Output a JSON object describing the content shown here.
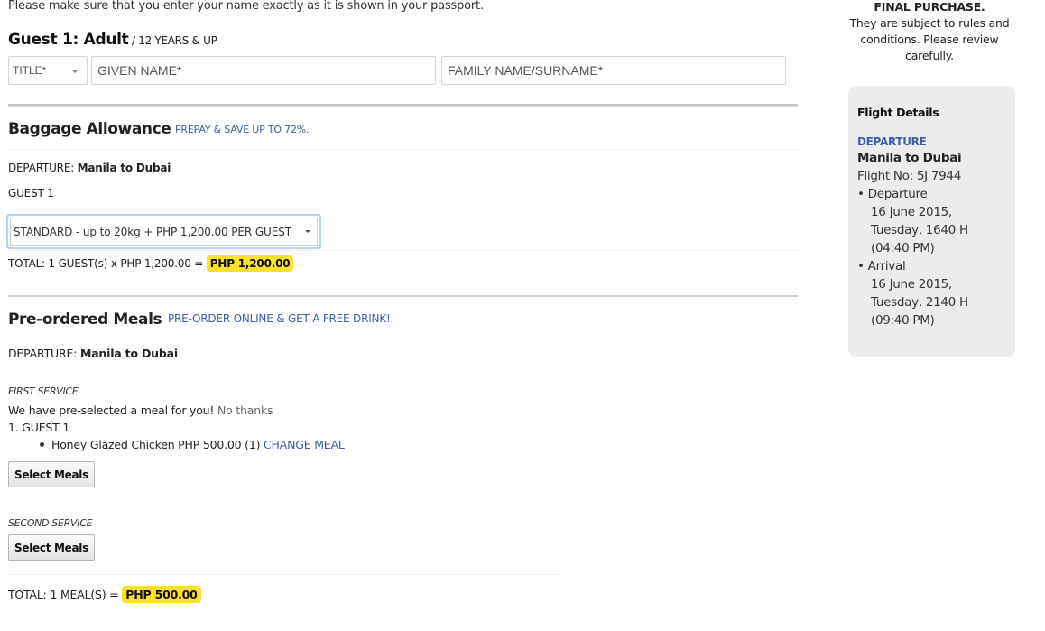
{
  "notice": "Please make sure that you enter your name exactly as it is shown in your passport.",
  "guest": {
    "heading": "Guest  1:  Adult",
    "subheading": " / 12 YEARS & UP",
    "title_select": "TITLE*",
    "given_name_placeholder": "GIVEN NAME*",
    "family_name_placeholder": "FAMILY NAME/SURNAME*"
  },
  "baggage": {
    "title": "Baggage Allowance",
    "promo": "PREPAY & SAVE UP TO 72%.",
    "departure_label": "DEPARTURE: ",
    "departure_route": "Manila  to  Dubai",
    "guest_label": "GUEST 1",
    "selected_option": "STANDARD - up to 20kg + PHP 1,200.00 PER GUEST",
    "total_label": "TOTAL:  1 GUEST(s) x PHP 1,200.00 = ",
    "total_value": "PHP  1,200.00"
  },
  "meals": {
    "title": "Pre-ordered Meals",
    "promo": "PRE-ORDER ONLINE & GET A FREE DRINK!",
    "departure_label": "DEPARTURE: ",
    "departure_route": "Manila  to  Dubai",
    "first_service": {
      "label": "FIRST SERVICE",
      "preselected_text": "We have pre-selected a meal for you! ",
      "no_thanks": "No thanks",
      "guest_label": "1. GUEST 1",
      "meal_item": "Honey Glazed Chicken PHP 500.00 (1) ",
      "change_meal": "CHANGE MEAL",
      "button": "Select Meals"
    },
    "second_service": {
      "label": "SECOND SERVICE",
      "button": "Select Meals"
    },
    "total_label": "TOTAL: 1 MEAL(S) = ",
    "total_value": "PHP 500.00"
  },
  "sidebar": {
    "final_purchase": "FINAL PURCHASE.",
    "rules_text": "They are subject to rules and conditions. Please review carefully.",
    "flight_details": {
      "title": "Flight Details",
      "direction": "DEPARTURE",
      "route": "Manila to Dubai",
      "flight_no": "Flight No: 5J 7944",
      "departure_label": "• Departure",
      "departure_date": "16 June 2015,",
      "departure_time": "Tuesday, 1640 H",
      "departure_time_12h": "(04:40 PM)",
      "arrival_label": "• Arrival",
      "arrival_date": "16 June 2015,",
      "arrival_time": "Tuesday, 2140 H",
      "arrival_time_12h": "(09:40 PM)"
    }
  },
  "colors": {
    "accent_blue": "#3d5fa8",
    "highlight_yellow": "#f9e12c",
    "card_gray": "#ececec"
  }
}
